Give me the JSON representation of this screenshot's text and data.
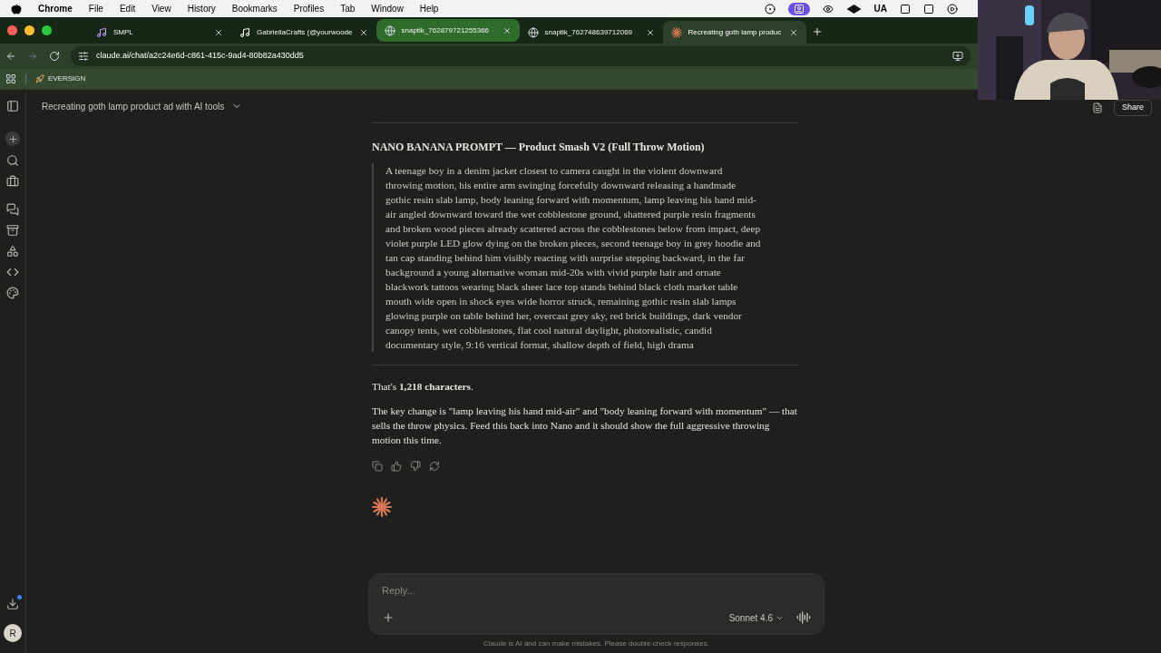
{
  "menu_bar": {
    "app": "Chrome",
    "items": [
      "File",
      "Edit",
      "View",
      "History",
      "Bookmarks",
      "Profiles",
      "Tab",
      "Window",
      "Help"
    ],
    "status_text": "UA"
  },
  "tabs": [
    {
      "title": "SMPL",
      "kind": "smpl",
      "selected": false,
      "highlighted": false
    },
    {
      "title": "GabriellaCrafts (@yourwoode",
      "kind": "tiktok",
      "selected": false,
      "highlighted": false
    },
    {
      "title": "snaptik_762879721255366",
      "kind": "globe",
      "selected": false,
      "highlighted": true
    },
    {
      "title": "snaptik_762748639712069",
      "kind": "globe",
      "selected": false,
      "highlighted": false
    },
    {
      "title": "Recreating goth lamp produc",
      "kind": "claude",
      "selected": true,
      "highlighted": false
    }
  ],
  "address_bar": {
    "url": "claude.ai/chat/a2c24e6d-c861-415c-9ad4-80b82a430dd5"
  },
  "bookmarks": [
    "EVERSIGN"
  ],
  "chat": {
    "title": "Recreating goth lamp product ad with AI tools",
    "share": "Share",
    "heading": "NANO BANANA PROMPT — Product Smash V2 (Full Throw Motion)",
    "quote": "A teenage boy in a denim jacket closest to camera caught in the violent downward throwing motion, his entire arm swinging forcefully downward releasing a handmade gothic resin slab lamp, body leaning forward with momentum, lamp leaving his hand mid-air angled downward toward the wet cobblestone ground, shattered purple resin fragments and broken wood pieces already scattered across the cobblestones below from impact, deep violet purple LED glow dying on the broken pieces, second teenage boy in grey hoodie and tan cap standing behind him visibly reacting with surprise stepping backward, in the far background a young alternative woman mid-20s with vivid purple hair and ornate blackwork tattoos wearing black sheer lace top stands behind black cloth market table mouth wide open in shock eyes wide horror struck, remaining gothic resin slab lamps glowing purple on table behind her, overcast grey sky, red brick buildings, dark vendor canopy tents, wet cobblestones, flat cool natural daylight, photorealistic, candid documentary style, 9:16 vertical format, shallow depth of field, high drama",
    "paragraphs": [
      "That's **1,218 characters**.",
      "The key change is \"lamp leaving his hand mid-air\" and \"body leaning forward with momentum\" — that sells the throw physics. Feed this back into Nano and it should show the full aggressive throwing motion this time."
    ]
  },
  "composer": {
    "placeholder": "Reply...",
    "model": "Sonnet 4.6"
  },
  "disclaimer": "Claude is AI and can make mistakes. Please double-check responses.",
  "avatar": "R"
}
